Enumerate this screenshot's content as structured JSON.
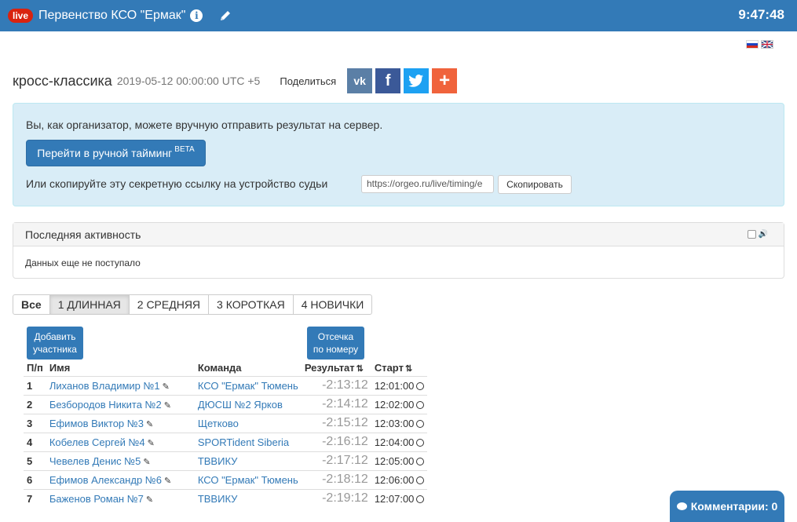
{
  "topbar": {
    "live_label": "live",
    "title": "Первенство КСО \"Ермак\"",
    "time": "9:47:48",
    "accent_color": "#337ab7"
  },
  "languages": [
    "ru-flag-icon",
    "en-flag-icon"
  ],
  "event": {
    "title": "кросс-классика",
    "datetime": "2019-05-12 00:00:00 UTC +5",
    "share_label": "Поделиться",
    "social": [
      "vk-icon",
      "facebook-icon",
      "twitter-icon",
      "add-icon"
    ]
  },
  "organizer_panel": {
    "text": "Вы, как организатор, можете вручную отправить результат на сервер.",
    "timing_button": "Перейти в ручной тайминг",
    "timing_badge": "BETA",
    "copy_text": "Или скопируйте эту секретную ссылку на устройство судьи",
    "secret_link": "https://orgeo.ru/live/timing/e",
    "copy_button": "Скопировать"
  },
  "activity": {
    "title": "Последняя активность",
    "empty_text": "Данных еще не поступало"
  },
  "tabs": [
    {
      "label": "Все",
      "bold": true
    },
    {
      "label": "1 ДЛИННАЯ",
      "active": true
    },
    {
      "label": "2 СРЕДНЯЯ"
    },
    {
      "label": "3 КОРОТКАЯ"
    },
    {
      "label": "4 НОВИЧКИ"
    }
  ],
  "buttons": {
    "add_participant_line1": "Добавить",
    "add_participant_line2": "участника",
    "cutoff_line1": "Отсечка",
    "cutoff_line2": "по номеру"
  },
  "table": {
    "headers": {
      "num": "П/п",
      "name": "Имя",
      "team": "Команда",
      "result": "Результат",
      "start": "Старт"
    },
    "rows": [
      {
        "num": "1",
        "name": "Лиханов Владимир №1",
        "team": "КСО \"Ермак\" Тюмень",
        "result": "-2:13:12",
        "start": "12:01:00"
      },
      {
        "num": "2",
        "name": "Безбородов Никита №2",
        "team": "ДЮСШ №2 Ярков",
        "result": "-2:14:12",
        "start": "12:02:00"
      },
      {
        "num": "3",
        "name": "Ефимов Виктор №3",
        "team": "Щетково",
        "result": "-2:15:12",
        "start": "12:03:00"
      },
      {
        "num": "4",
        "name": "Кобелев Сергей №4",
        "team": "SPORTident Siberia",
        "result": "-2:16:12",
        "start": "12:04:00"
      },
      {
        "num": "5",
        "name": "Чевелев Денис №5",
        "team": "ТВВИКУ",
        "result": "-2:17:12",
        "start": "12:05:00"
      },
      {
        "num": "6",
        "name": "Ефимов Александр №6",
        "team": "КСО \"Ермак\" Тюмень",
        "result": "-2:18:12",
        "start": "12:06:00"
      },
      {
        "num": "7",
        "name": "Баженов Роман №7",
        "team": "ТВВИКУ",
        "result": "-2:19:12",
        "start": "12:07:00"
      }
    ]
  },
  "comments": {
    "label": "Комментарии: 0"
  }
}
